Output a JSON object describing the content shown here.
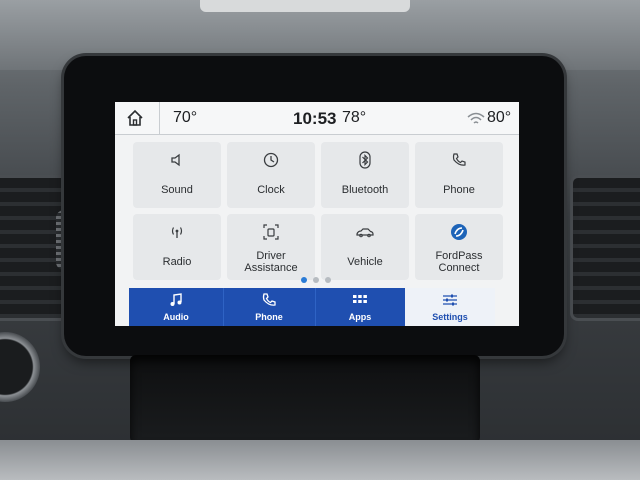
{
  "status_bar": {
    "temp_left": "70°",
    "clock": "10:53",
    "temp_center": "78°",
    "temp_right": "80°"
  },
  "apps": [
    {
      "label": "Sound",
      "icon": "speaker-icon"
    },
    {
      "label": "Clock",
      "icon": "clock-icon"
    },
    {
      "label": "Bluetooth",
      "icon": "bluetooth-icon"
    },
    {
      "label": "Phone",
      "icon": "phone-icon"
    },
    {
      "label": "Radio",
      "icon": "radio-antenna-icon"
    },
    {
      "label_line1": "Driver",
      "label_line2": "Assistance",
      "icon": "driver-assist-icon"
    },
    {
      "label": "Vehicle",
      "icon": "car-icon"
    },
    {
      "label_line1": "FordPass",
      "label_line2": "Connect",
      "icon": "fordpass-icon"
    }
  ],
  "pagination": {
    "pages": 3,
    "current": 1
  },
  "dock": [
    {
      "label": "Audio",
      "icon": "music-note-icon"
    },
    {
      "label": "Phone",
      "icon": "phone-icon"
    },
    {
      "label": "Apps",
      "icon": "apps-grid-icon"
    },
    {
      "label": "Settings",
      "icon": "sliders-icon",
      "active": true
    }
  ],
  "colors": {
    "dock_blue": "#1f4fb0",
    "accent": "#2a7bd6"
  }
}
